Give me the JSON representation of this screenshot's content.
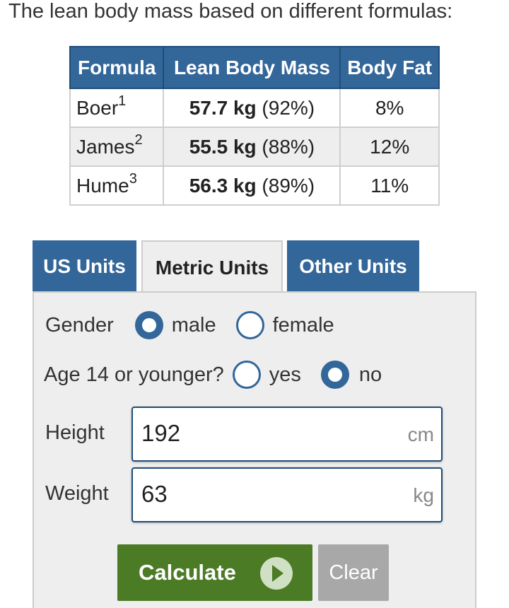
{
  "intro": "The lean body mass based on different formulas:",
  "table": {
    "headers": [
      "Formula",
      "Lean Body Mass",
      "Body Fat"
    ],
    "rows": [
      {
        "formula": "Boer",
        "sup": "1",
        "lbm": "57.7 kg",
        "pct": "(92%)",
        "fat": "8%"
      },
      {
        "formula": "James",
        "sup": "2",
        "lbm": "55.5 kg",
        "pct": "(88%)",
        "fat": "12%"
      },
      {
        "formula": "Hume",
        "sup": "3",
        "lbm": "56.3 kg",
        "pct": "(89%)",
        "fat": "11%"
      }
    ]
  },
  "tabs": [
    {
      "label": "US Units",
      "active": false
    },
    {
      "label": "Metric Units",
      "active": true
    },
    {
      "label": "Other Units",
      "active": false
    }
  ],
  "form": {
    "gender_label": "Gender",
    "gender_male": "male",
    "gender_female": "female",
    "gender_selected": "male",
    "age_label": "Age 14 or younger?",
    "age_yes": "yes",
    "age_no": "no",
    "age_selected": "no",
    "height_label": "Height",
    "height_value": "192",
    "height_unit": "cm",
    "weight_label": "Weight",
    "weight_value": "63",
    "weight_unit": "kg"
  },
  "buttons": {
    "calculate": "Calculate",
    "clear": "Clear"
  },
  "colors": {
    "header_blue": "#336699",
    "calc_green": "#4c7b26",
    "clear_gray": "#a8a8a8",
    "panel_bg": "#eeeeee"
  }
}
